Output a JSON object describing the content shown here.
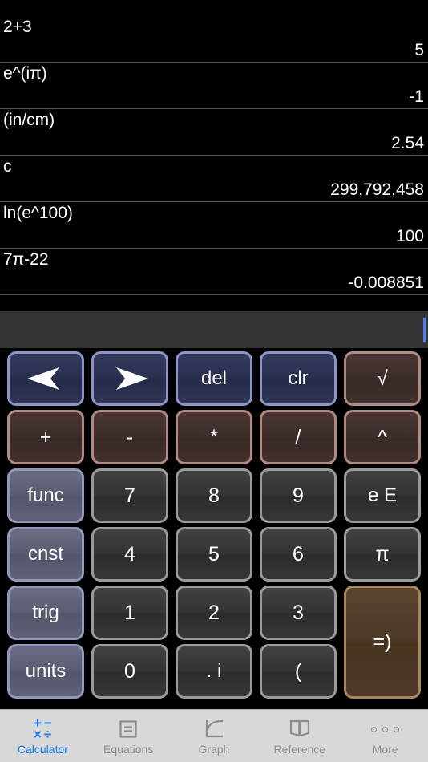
{
  "app": {
    "title": "Calculator"
  },
  "history": {
    "rows": [
      {
        "expression": "2+3",
        "result": "5"
      },
      {
        "expression": "e^(iπ)",
        "result": "-1"
      },
      {
        "expression": "(in/cm)",
        "result": "2.54"
      },
      {
        "expression": "c",
        "result": "299,792,458"
      },
      {
        "expression": "ln(e^100)",
        "result": "100"
      },
      {
        "expression": "7π-22",
        "result": "-0.008851"
      }
    ]
  },
  "entry": {
    "value": "",
    "placeholder": "",
    "caret_color": "#4a7dff",
    "background": "#333333"
  },
  "keypad": {
    "keys": [
      {
        "id": "cursor-left",
        "label": "",
        "icon": "arrow-left-icon",
        "style": "nav",
        "col": 0,
        "row": 0
      },
      {
        "id": "cursor-right",
        "label": "",
        "icon": "arrow-right-icon",
        "style": "nav",
        "col": 1,
        "row": 0
      },
      {
        "id": "del",
        "label": "del",
        "icon": "",
        "style": "nav",
        "col": 2,
        "row": 0
      },
      {
        "id": "clr",
        "label": "clr",
        "icon": "",
        "style": "nav",
        "col": 3,
        "row": 0
      },
      {
        "id": "sqrt",
        "label": "√",
        "icon": "",
        "style": "op",
        "col": 4,
        "row": 0
      },
      {
        "id": "plus",
        "label": "+",
        "icon": "",
        "style": "op",
        "col": 0,
        "row": 1
      },
      {
        "id": "minus",
        "label": "-",
        "icon": "",
        "style": "op",
        "col": 1,
        "row": 1
      },
      {
        "id": "multiply",
        "label": "*",
        "icon": "",
        "style": "op",
        "col": 2,
        "row": 1
      },
      {
        "id": "divide",
        "label": "/",
        "icon": "",
        "style": "op",
        "col": 3,
        "row": 1
      },
      {
        "id": "power",
        "label": "^",
        "icon": "",
        "style": "op",
        "col": 4,
        "row": 1
      },
      {
        "id": "func",
        "label": "func",
        "icon": "",
        "style": "side",
        "col": 0,
        "row": 2
      },
      {
        "id": "seven",
        "label": "7",
        "icon": "",
        "style": "num",
        "col": 1,
        "row": 2
      },
      {
        "id": "eight",
        "label": "8",
        "icon": "",
        "style": "num",
        "col": 2,
        "row": 2
      },
      {
        "id": "nine",
        "label": "9",
        "icon": "",
        "style": "num",
        "col": 3,
        "row": 2
      },
      {
        "id": "e-exp",
        "label": "e E",
        "icon": "",
        "style": "num",
        "col": 4,
        "row": 2
      },
      {
        "id": "cnst",
        "label": "cnst",
        "icon": "",
        "style": "side",
        "col": 0,
        "row": 3
      },
      {
        "id": "four",
        "label": "4",
        "icon": "",
        "style": "num",
        "col": 1,
        "row": 3
      },
      {
        "id": "five",
        "label": "5",
        "icon": "",
        "style": "num",
        "col": 2,
        "row": 3
      },
      {
        "id": "six",
        "label": "6",
        "icon": "",
        "style": "num",
        "col": 3,
        "row": 3
      },
      {
        "id": "pi",
        "label": "π",
        "icon": "",
        "style": "num",
        "col": 4,
        "row": 3
      },
      {
        "id": "trig",
        "label": "trig",
        "icon": "",
        "style": "side",
        "col": 0,
        "row": 4
      },
      {
        "id": "one",
        "label": "1",
        "icon": "",
        "style": "num",
        "col": 1,
        "row": 4
      },
      {
        "id": "two",
        "label": "2",
        "icon": "",
        "style": "num",
        "col": 2,
        "row": 4
      },
      {
        "id": "three",
        "label": "3",
        "icon": "",
        "style": "num",
        "col": 3,
        "row": 4
      },
      {
        "id": "units",
        "label": "units",
        "icon": "",
        "style": "side",
        "col": 0,
        "row": 5
      },
      {
        "id": "zero",
        "label": "0",
        "icon": "",
        "style": "num",
        "col": 1,
        "row": 5
      },
      {
        "id": "dot-i",
        "label": ". i",
        "icon": "",
        "style": "num",
        "col": 2,
        "row": 5
      },
      {
        "id": "paren",
        "label": "(",
        "icon": "",
        "style": "num",
        "col": 3,
        "row": 5
      },
      {
        "id": "equals",
        "label": "=)",
        "icon": "",
        "style": "eq",
        "col": 4,
        "row": 4,
        "tall": true
      }
    ]
  },
  "tabbar": {
    "active": "calculator",
    "active_color": "#1277f0",
    "inactive_color": "#8c8c8c",
    "tabs": [
      {
        "id": "calculator",
        "label": "Calculator",
        "icon": "calculator-icon",
        "active": true
      },
      {
        "id": "equations",
        "label": "Equations",
        "icon": "equations-icon",
        "active": false
      },
      {
        "id": "graph",
        "label": "Graph",
        "icon": "graph-icon",
        "active": false
      },
      {
        "id": "reference",
        "label": "Reference",
        "icon": "book-icon",
        "active": false
      },
      {
        "id": "more",
        "label": "More",
        "icon": "ellipsis-icon",
        "active": false
      }
    ]
  },
  "calculator_icon_symbols": {
    "a": "+",
    "b": "−",
    "c": "×",
    "d": "÷"
  }
}
